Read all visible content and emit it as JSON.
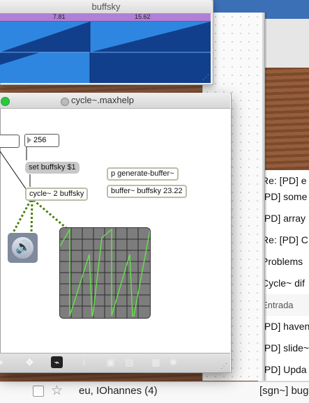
{
  "buffsky_window": {
    "title": "buffsky",
    "ruler_left": "7.81",
    "ruler_right": "15.62"
  },
  "help_window": {
    "title": "cycle~.maxhelp",
    "number_box": "256",
    "message_set": "set buffsky $1",
    "object_cycle": "cycle~ 2 buffsky",
    "object_pgen": "p generate-buffer~",
    "object_buffer": "buffer~ buffsky 23.22"
  },
  "mail_list": {
    "rows": [
      "Re: [PD] e",
      "[PD] some",
      "[PD] array",
      "Re: [PD] C",
      "Problems",
      "Cycle~ dif",
      "Entrada",
      "[PD] haven",
      "[PD] slide~",
      "[PD] Upda"
    ],
    "bottom_sender": "eu, IOhannes (4)",
    "bottom_subject": "[sgn~] bug"
  },
  "colors": {
    "accent_close": "#28c840",
    "ruler": "#b07fd8",
    "wave_light": "#2e86e0",
    "wave_dark": "#123f8c",
    "scope_trace": "#66e24a"
  }
}
